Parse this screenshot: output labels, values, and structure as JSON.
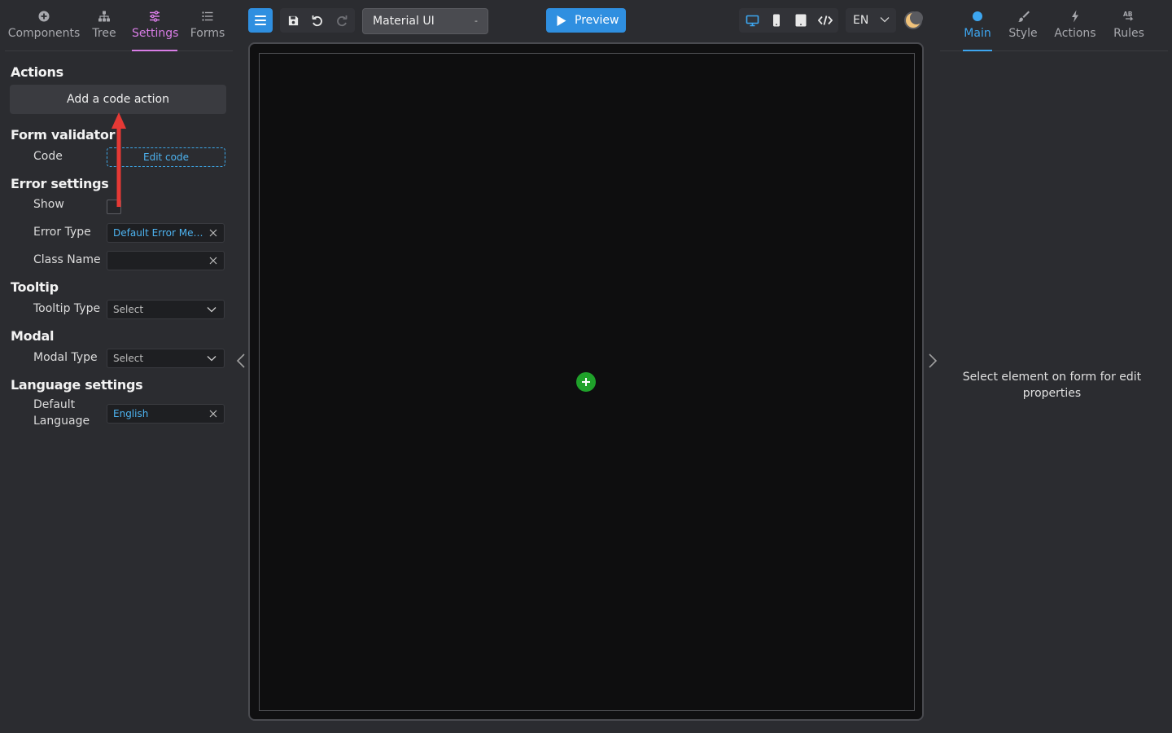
{
  "left_tabs": [
    {
      "label": "Components",
      "icon": "plus-circle-icon"
    },
    {
      "label": "Tree",
      "icon": "tree-icon"
    },
    {
      "label": "Settings",
      "icon": "sliders-icon",
      "active": true
    },
    {
      "label": "Forms",
      "icon": "list-icon"
    }
  ],
  "actions": {
    "title": "Actions",
    "add_label": "Add a code action"
  },
  "form_validator": {
    "title": "Form validator",
    "code_label": "Code",
    "edit_label": "Edit code"
  },
  "error_settings": {
    "title": "Error settings",
    "show_label": "Show",
    "show_checked": false,
    "error_type_label": "Error Type",
    "error_type_value": "Default Error Mes...",
    "class_name_label": "Class Name",
    "class_name_value": ""
  },
  "tooltip": {
    "title": "Tooltip",
    "type_label": "Tooltip Type",
    "type_value": "Select"
  },
  "modal": {
    "title": "Modal",
    "type_label": "Modal Type",
    "type_value": "Select"
  },
  "language_settings": {
    "title": "Language settings",
    "default_label_1": "Default",
    "default_label_2": "Language",
    "default_value": "English"
  },
  "toolbar": {
    "theme_value": "Material UI",
    "theme_caret": "-",
    "preview_label": "Preview",
    "lang_value": "EN"
  },
  "right_tabs": [
    {
      "label": "Main",
      "icon": "dot-icon",
      "active": true
    },
    {
      "label": "Style",
      "icon": "brush-icon"
    },
    {
      "label": "Actions",
      "icon": "bolt-icon"
    },
    {
      "label": "Rules",
      "icon": "ab-rules-icon"
    }
  ],
  "right_icons": {
    "rules_glyph": "AB"
  },
  "right_hint": {
    "line1": "Select element on form for edit",
    "line2": "properties"
  },
  "colors": {
    "accent_blue": "#2f8fe0",
    "settings_pink": "#d97de6",
    "add_green": "#1fa12a",
    "arrow_red": "#e53935"
  }
}
